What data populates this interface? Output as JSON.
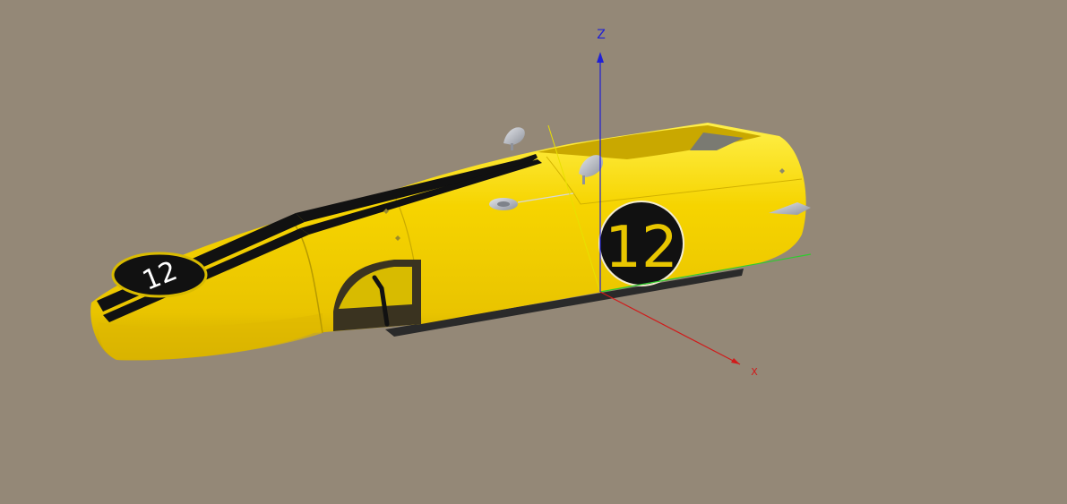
{
  "viewport": {
    "background_color": "#948877",
    "axes": {
      "z_label": "Z",
      "x_label": "X",
      "z_color": "#1f1fd6",
      "x_color": "#d11a1a",
      "y_color": "#2ecc2e"
    }
  },
  "model": {
    "name": "race-car-body",
    "body_color": "#f6d400",
    "stripe_color": "#111111",
    "parts_color": "#b9bcc4",
    "race_number_side": "12",
    "race_number_nose": "12",
    "number_text_color": "#e8c600"
  }
}
